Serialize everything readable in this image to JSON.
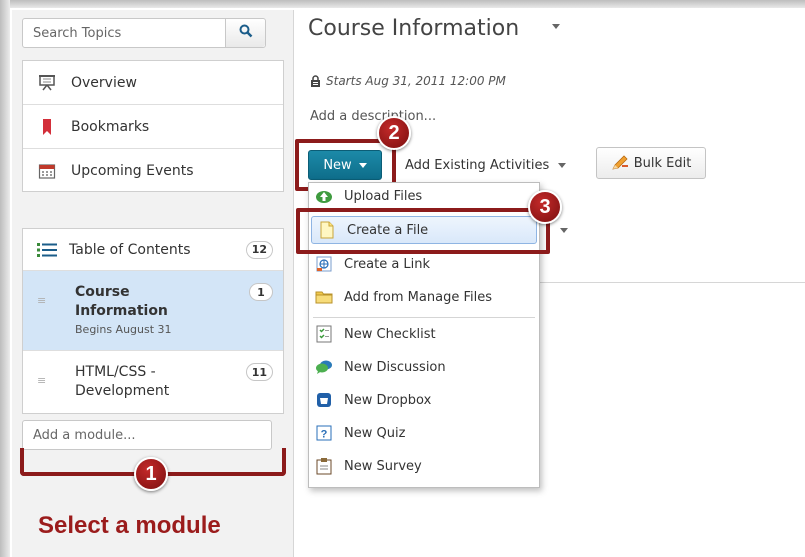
{
  "search": {
    "placeholder": "Search Topics"
  },
  "nav": {
    "items": [
      {
        "label": "Overview",
        "icon": "overview-icon"
      },
      {
        "label": "Bookmarks",
        "icon": "bookmark-icon"
      },
      {
        "label": "Upcoming Events",
        "icon": "calendar-icon"
      }
    ]
  },
  "toc": {
    "label": "Table of Contents",
    "count": "12",
    "modules": [
      {
        "title": "Course Information",
        "subtitle": "Begins August 31",
        "count": "1",
        "active": true
      },
      {
        "title": "HTML/CSS - Development",
        "subtitle": "",
        "count": "11",
        "active": false
      }
    ],
    "add_placeholder": "Add a module..."
  },
  "main": {
    "title": "Course Information",
    "starts": "Starts Aug 31, 2011 12:00 PM",
    "add_description": "Add a description...",
    "new_label": "New",
    "existing_label": "Add Existing Activities",
    "bulk_label": "Bulk Edit"
  },
  "menu": {
    "items": [
      {
        "label": "Upload Files",
        "icon": "upload-icon"
      },
      {
        "label": "Create a File",
        "icon": "file-icon"
      },
      {
        "label": "Create a Link",
        "icon": "link-icon"
      },
      {
        "label": "Add from Manage Files",
        "icon": "folder-icon"
      },
      {
        "label": "New Checklist",
        "icon": "checklist-icon"
      },
      {
        "label": "New Discussion",
        "icon": "discussion-icon"
      },
      {
        "label": "New Dropbox",
        "icon": "dropbox-icon"
      },
      {
        "label": "New Quiz",
        "icon": "quiz-icon"
      },
      {
        "label": "New Survey",
        "icon": "survey-icon"
      }
    ]
  },
  "annotations": {
    "step1": "1",
    "step2": "2",
    "step3": "3",
    "select_text": "Select a module"
  },
  "colors": {
    "accent": "#0e6d8a",
    "callout": "#8c1b1b",
    "active_module": "#d3e5f7"
  }
}
